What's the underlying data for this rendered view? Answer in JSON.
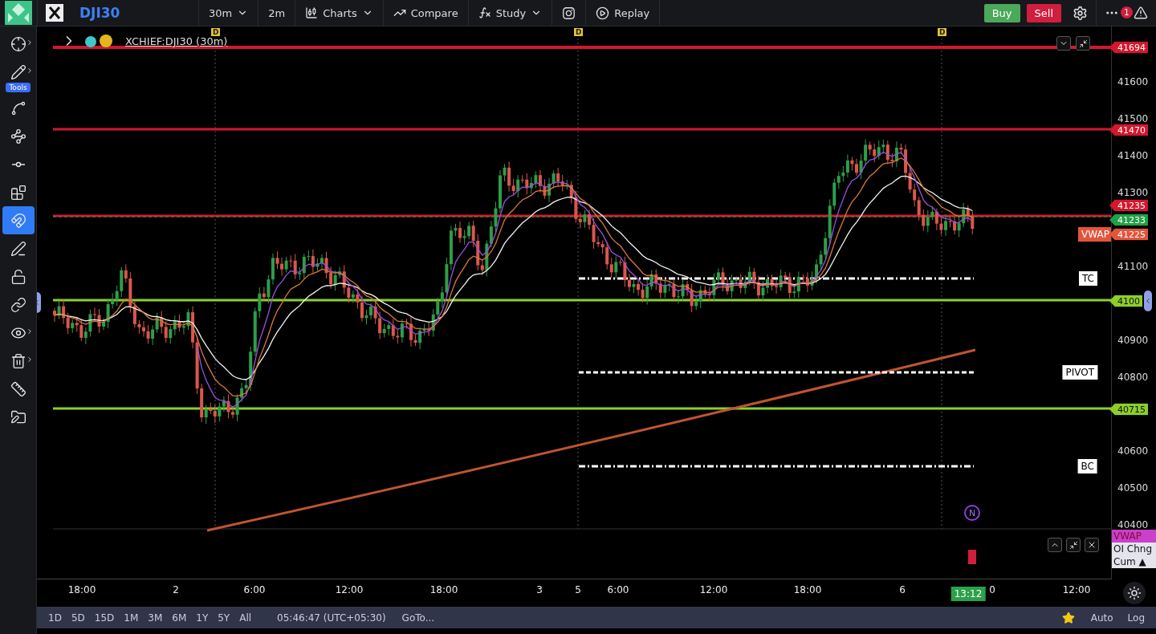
{
  "top_bar": {
    "symbol": "DJI30",
    "interval": "30m",
    "interval_alt": "2m",
    "menus": [
      {
        "kind": "charts",
        "label": "Charts",
        "dropdown": true
      },
      {
        "kind": "compare",
        "label": "Compare",
        "dropdown": false
      },
      {
        "kind": "study",
        "label": "Study",
        "dropdown": true
      }
    ],
    "replay": "Replay",
    "buy": "Buy",
    "sell": "Sell",
    "notification_count": "1"
  },
  "tools": {
    "label": "Tools",
    "items": [
      {
        "kind": "crosshair",
        "selected": false,
        "submenu": true
      },
      {
        "kind": "pencil",
        "selected": false,
        "submenu": true
      },
      {
        "kind": "measure",
        "selected": false,
        "submenu": false
      },
      {
        "kind": "pattern",
        "selected": false,
        "submenu": false
      },
      {
        "kind": "line",
        "selected": false,
        "submenu": false
      },
      {
        "kind": "text",
        "selected": false,
        "submenu": false
      },
      {
        "kind": "magnet",
        "selected": true,
        "submenu": false
      },
      {
        "kind": "lockdraw",
        "selected": false,
        "submenu": false
      },
      {
        "kind": "lock",
        "selected": false,
        "submenu": false
      },
      {
        "kind": "link",
        "selected": false,
        "submenu": false
      },
      {
        "kind": "eye",
        "selected": false,
        "submenu": true
      },
      {
        "kind": "trash",
        "selected": false,
        "submenu": true
      },
      {
        "kind": "ruler",
        "selected": false,
        "submenu": false
      },
      {
        "kind": "folder",
        "selected": false,
        "submenu": false
      }
    ]
  },
  "chart": {
    "title": "XCHIEF:DJI30 (30m)",
    "day_markers": [
      "D",
      "D",
      "D"
    ],
    "price_ticks": [
      "41600",
      "41500",
      "41400",
      "41300",
      "41100",
      "40900",
      "40800",
      "40600",
      "40500",
      "40400"
    ],
    "price_tags": [
      {
        "kind": "level",
        "text": "41694",
        "color": "#d3172f"
      },
      {
        "kind": "level",
        "text": "41470",
        "color": "#d3172f"
      },
      {
        "kind": "level",
        "text": "41235",
        "color": "#d3172f"
      },
      {
        "kind": "price",
        "text": "41233",
        "color": "#21a047"
      },
      {
        "kind": "indicator",
        "text": "41225",
        "color": "#e2553c"
      },
      {
        "kind": "level",
        "text": "4100",
        "color": "#8ccf2c"
      },
      {
        "kind": "level",
        "text": "40715",
        "color": "#8ccf2c"
      }
    ],
    "vwap_label": "VWAP",
    "level_labels": [
      "TC",
      "PIVOT",
      "BC"
    ],
    "news_marker": "N",
    "time_labels": [
      "18:00",
      "2",
      "6:00",
      "12:00",
      "18:00",
      "3",
      "5",
      "6:00",
      "12:00",
      "18:00",
      "6",
      "0",
      "12:00"
    ],
    "current_time": "13:12",
    "legend": [
      {
        "label": "VWAP",
        "selected": true
      },
      {
        "label": "OI Chng",
        "selected": false
      },
      {
        "label": "Cum ▲",
        "selected": false
      }
    ]
  },
  "bottom_bar": {
    "ranges": [
      "1D",
      "5D",
      "15D",
      "1M",
      "3M",
      "6M",
      "1Y",
      "5Y",
      "All"
    ],
    "clock": "05:46:47 (UTC+05:30)",
    "goto": "GoTo...",
    "auto": "Auto",
    "log": "Log"
  }
}
